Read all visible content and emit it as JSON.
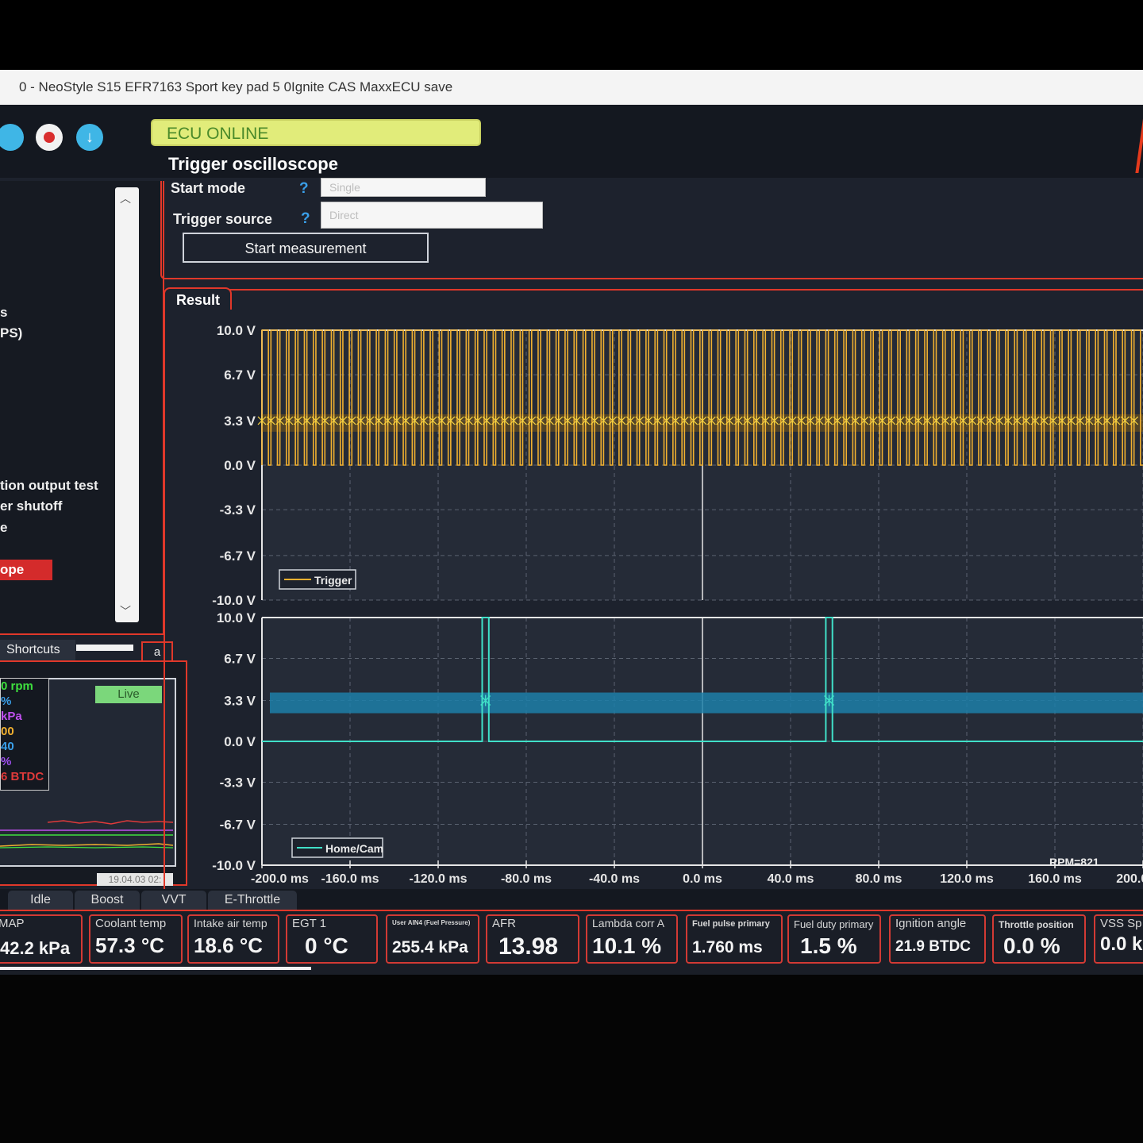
{
  "window": {
    "title": "0 - NeoStyle S15 EFR7163 Sport key pad 5 0Ignite CAS MaxxECU save"
  },
  "status": {
    "ecu": "ECU ONLINE"
  },
  "colors": {
    "accent": "#e0382a",
    "trigger": "#f0b030",
    "home": "#40e0c8",
    "status_bg": "#e1ec7a"
  },
  "sidebar": {
    "items": [
      {
        "label": "s"
      },
      {
        "label": "PS)"
      },
      {
        "label": "tion output test"
      },
      {
        "label": "er shutoff"
      },
      {
        "label": "e"
      }
    ],
    "active_item": "ope"
  },
  "shortcuts": {
    "tab": "Shortcuts",
    "button": "a",
    "live": "Live",
    "date": "19.04.03 02:",
    "legend": [
      {
        "text": "0 rpm",
        "color": "#3ee03e"
      },
      {
        "text": "%",
        "color": "#3aa0ea"
      },
      {
        "text": " kPa",
        "color": "#c050f0"
      },
      {
        "text": "00",
        "color": "#f0b030"
      },
      {
        "text": "40",
        "color": "#3aa0ea"
      },
      {
        "text": "%",
        "color": "#a050f0"
      },
      {
        "text": "6 BTDC",
        "color": "#e03a3a"
      }
    ]
  },
  "oscilloscope": {
    "title": "Trigger oscilloscope",
    "start_mode_label": "Start mode",
    "start_mode_value": "Single",
    "trigger_source_label": "Trigger source",
    "trigger_source_value": "Direct",
    "help": "?",
    "start_button": "Start measurement"
  },
  "result": {
    "tab": "Result",
    "rpm": "RPM=821",
    "y_ticks_top": [
      "10.0 V",
      "6.7 V",
      "3.3 V",
      "0.0 V",
      "-3.3 V",
      "-6.7 V",
      "-10.0 V"
    ],
    "y_ticks_bottom": [
      "10.0 V",
      "6.7 V",
      "3.3 V",
      "0.0 V",
      "-3.3 V",
      "-6.7 V",
      "-10.0 V"
    ],
    "x_ticks": [
      "-200.0 ms",
      "-160.0 ms",
      "-120.0 ms",
      "-80.0 ms",
      "-40.0 ms",
      "0.0 ms",
      "40.0 ms",
      "80.0 ms",
      "120.0 ms",
      "160.0 ms",
      "200.0 ms"
    ]
  },
  "chart_data": [
    {
      "type": "line",
      "series": [
        {
          "name": "Trigger",
          "values": "square wave 0.0 V to 10.0 V, ~98 pulses across window, threshold marks at 3.3 V"
        }
      ],
      "x_range_ms": [
        -200,
        200
      ],
      "ylim": [
        -10,
        10
      ],
      "trigger_level": 3.3,
      "pulse_count": 98,
      "high": 10.0,
      "low": 0.0,
      "grid": true,
      "legend": "bottom-left"
    },
    {
      "type": "line",
      "series": [
        {
          "name": "Home/Cam",
          "values": "0.0 V baseline with pulses to 10.0 V"
        }
      ],
      "x_range_ms": [
        -200,
        200
      ],
      "ylim": [
        -10,
        10
      ],
      "pulses_ms": [
        -100,
        56
      ],
      "pulse_width_ms": 3,
      "trigger_level": 3.3,
      "grid": true,
      "legend": "bottom-left"
    }
  ],
  "bottom_tabs": [
    "Idle",
    "Boost",
    "VVT",
    "E-Throttle"
  ],
  "gauges": [
    {
      "label": "MAP",
      "value": "42.2 kPa"
    },
    {
      "label": "Coolant temp",
      "value": "57.3 °C"
    },
    {
      "label": "Intake air temp",
      "value": "18.6 °C"
    },
    {
      "label": "EGT 1",
      "value": "0 °C"
    },
    {
      "label": "User AIN4 (Fuel Pressure)",
      "value": "255.4 kPa"
    },
    {
      "label": "AFR",
      "value": "13.98"
    },
    {
      "label": "Lambda corr A",
      "value": "10.1 %"
    },
    {
      "label": "Fuel pulse primary",
      "value": "1.760 ms"
    },
    {
      "label": "Fuel duty primary",
      "value": "1.5 %"
    },
    {
      "label": "Ignition angle",
      "value": "21.9 BTDC"
    },
    {
      "label": "Throttle position",
      "value": "0.0 %"
    },
    {
      "label": "VSS Sp",
      "value": "0.0 k"
    }
  ]
}
